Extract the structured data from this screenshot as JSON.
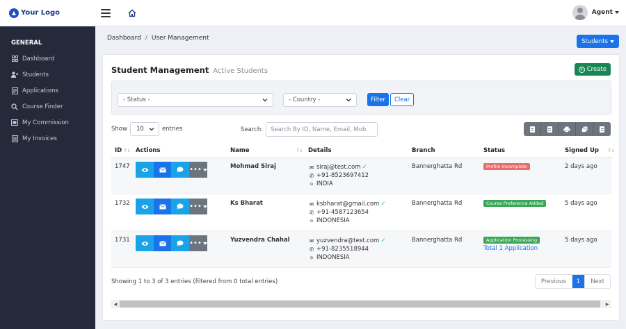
{
  "header": {
    "logo_text": "Your Logo",
    "user_name": "Agent"
  },
  "sidebar": {
    "section_title": "GENERAL",
    "items": [
      {
        "label": "Dashboard",
        "icon": "grid-icon"
      },
      {
        "label": "Students",
        "icon": "users-icon"
      },
      {
        "label": "Applications",
        "icon": "document-icon"
      },
      {
        "label": "Course Finder",
        "icon": "search-icon"
      },
      {
        "label": "My Commission",
        "icon": "commission-icon"
      },
      {
        "label": "My Invoices",
        "icon": "invoice-icon"
      }
    ]
  },
  "breadcrumb": {
    "home": "Dashboard",
    "separator": "/",
    "current": "User Management"
  },
  "students_button": "Students",
  "card": {
    "title": "Student Management",
    "subtitle": "Active Students",
    "create_label": "Create"
  },
  "filters": {
    "status_placeholder": "- Status -",
    "country_placeholder": "- Country -",
    "filter_label": "Filter",
    "clear_label": "Clear"
  },
  "table_controls": {
    "show_label": "Show",
    "entries_value": "10",
    "entries_label": "entries",
    "search_label": "Search:",
    "search_placeholder": "Search By ID, Name, Email, Mob"
  },
  "export_buttons": [
    "csv-export-icon",
    "pdf-export-icon",
    "print-icon",
    "copy-icon",
    "excel-export-icon"
  ],
  "table": {
    "columns": [
      "ID",
      "Actions",
      "Name",
      "Details",
      "Branch",
      "Status",
      "Signed Up"
    ],
    "rows": [
      {
        "id": "1747",
        "name": "Mohmad Siraj",
        "email": "siraj@test.com",
        "phone": "+91-8523697412",
        "country": "INDIA",
        "branch": "Bannerghatta Rd",
        "status": "Profile Incomplete",
        "status_color": "#e96a6a",
        "status_link": "",
        "signed_up": "2 days ago"
      },
      {
        "id": "1732",
        "name": "Ks Bharat",
        "email": "ksbharat@gmail.com",
        "phone": "+91-4587123654",
        "country": "INDONESIA",
        "branch": "Bannerghatta Rd",
        "status": "Course Preference Added",
        "status_color": "#3aa757",
        "status_link": "",
        "signed_up": "5 days ago"
      },
      {
        "id": "1731",
        "name": "Yuzvendra Chahal",
        "email": "yuzvendra@test.com",
        "phone": "+91-8235518944",
        "country": "INDONESIA",
        "branch": "Bannerghatta Rd",
        "status": "Application Processing",
        "status_color": "#3aa757",
        "status_link": "Total 1 Application",
        "signed_up": "5 days ago"
      }
    ]
  },
  "footer": {
    "info": "Showing 1 to 3 of 3 entries (filtered from 0 total entries)",
    "previous": "Previous",
    "page": "1",
    "next": "Next"
  },
  "colors": {
    "sidebar_bg": "#242a3a",
    "primary": "#1a73e8",
    "success": "#198754"
  }
}
